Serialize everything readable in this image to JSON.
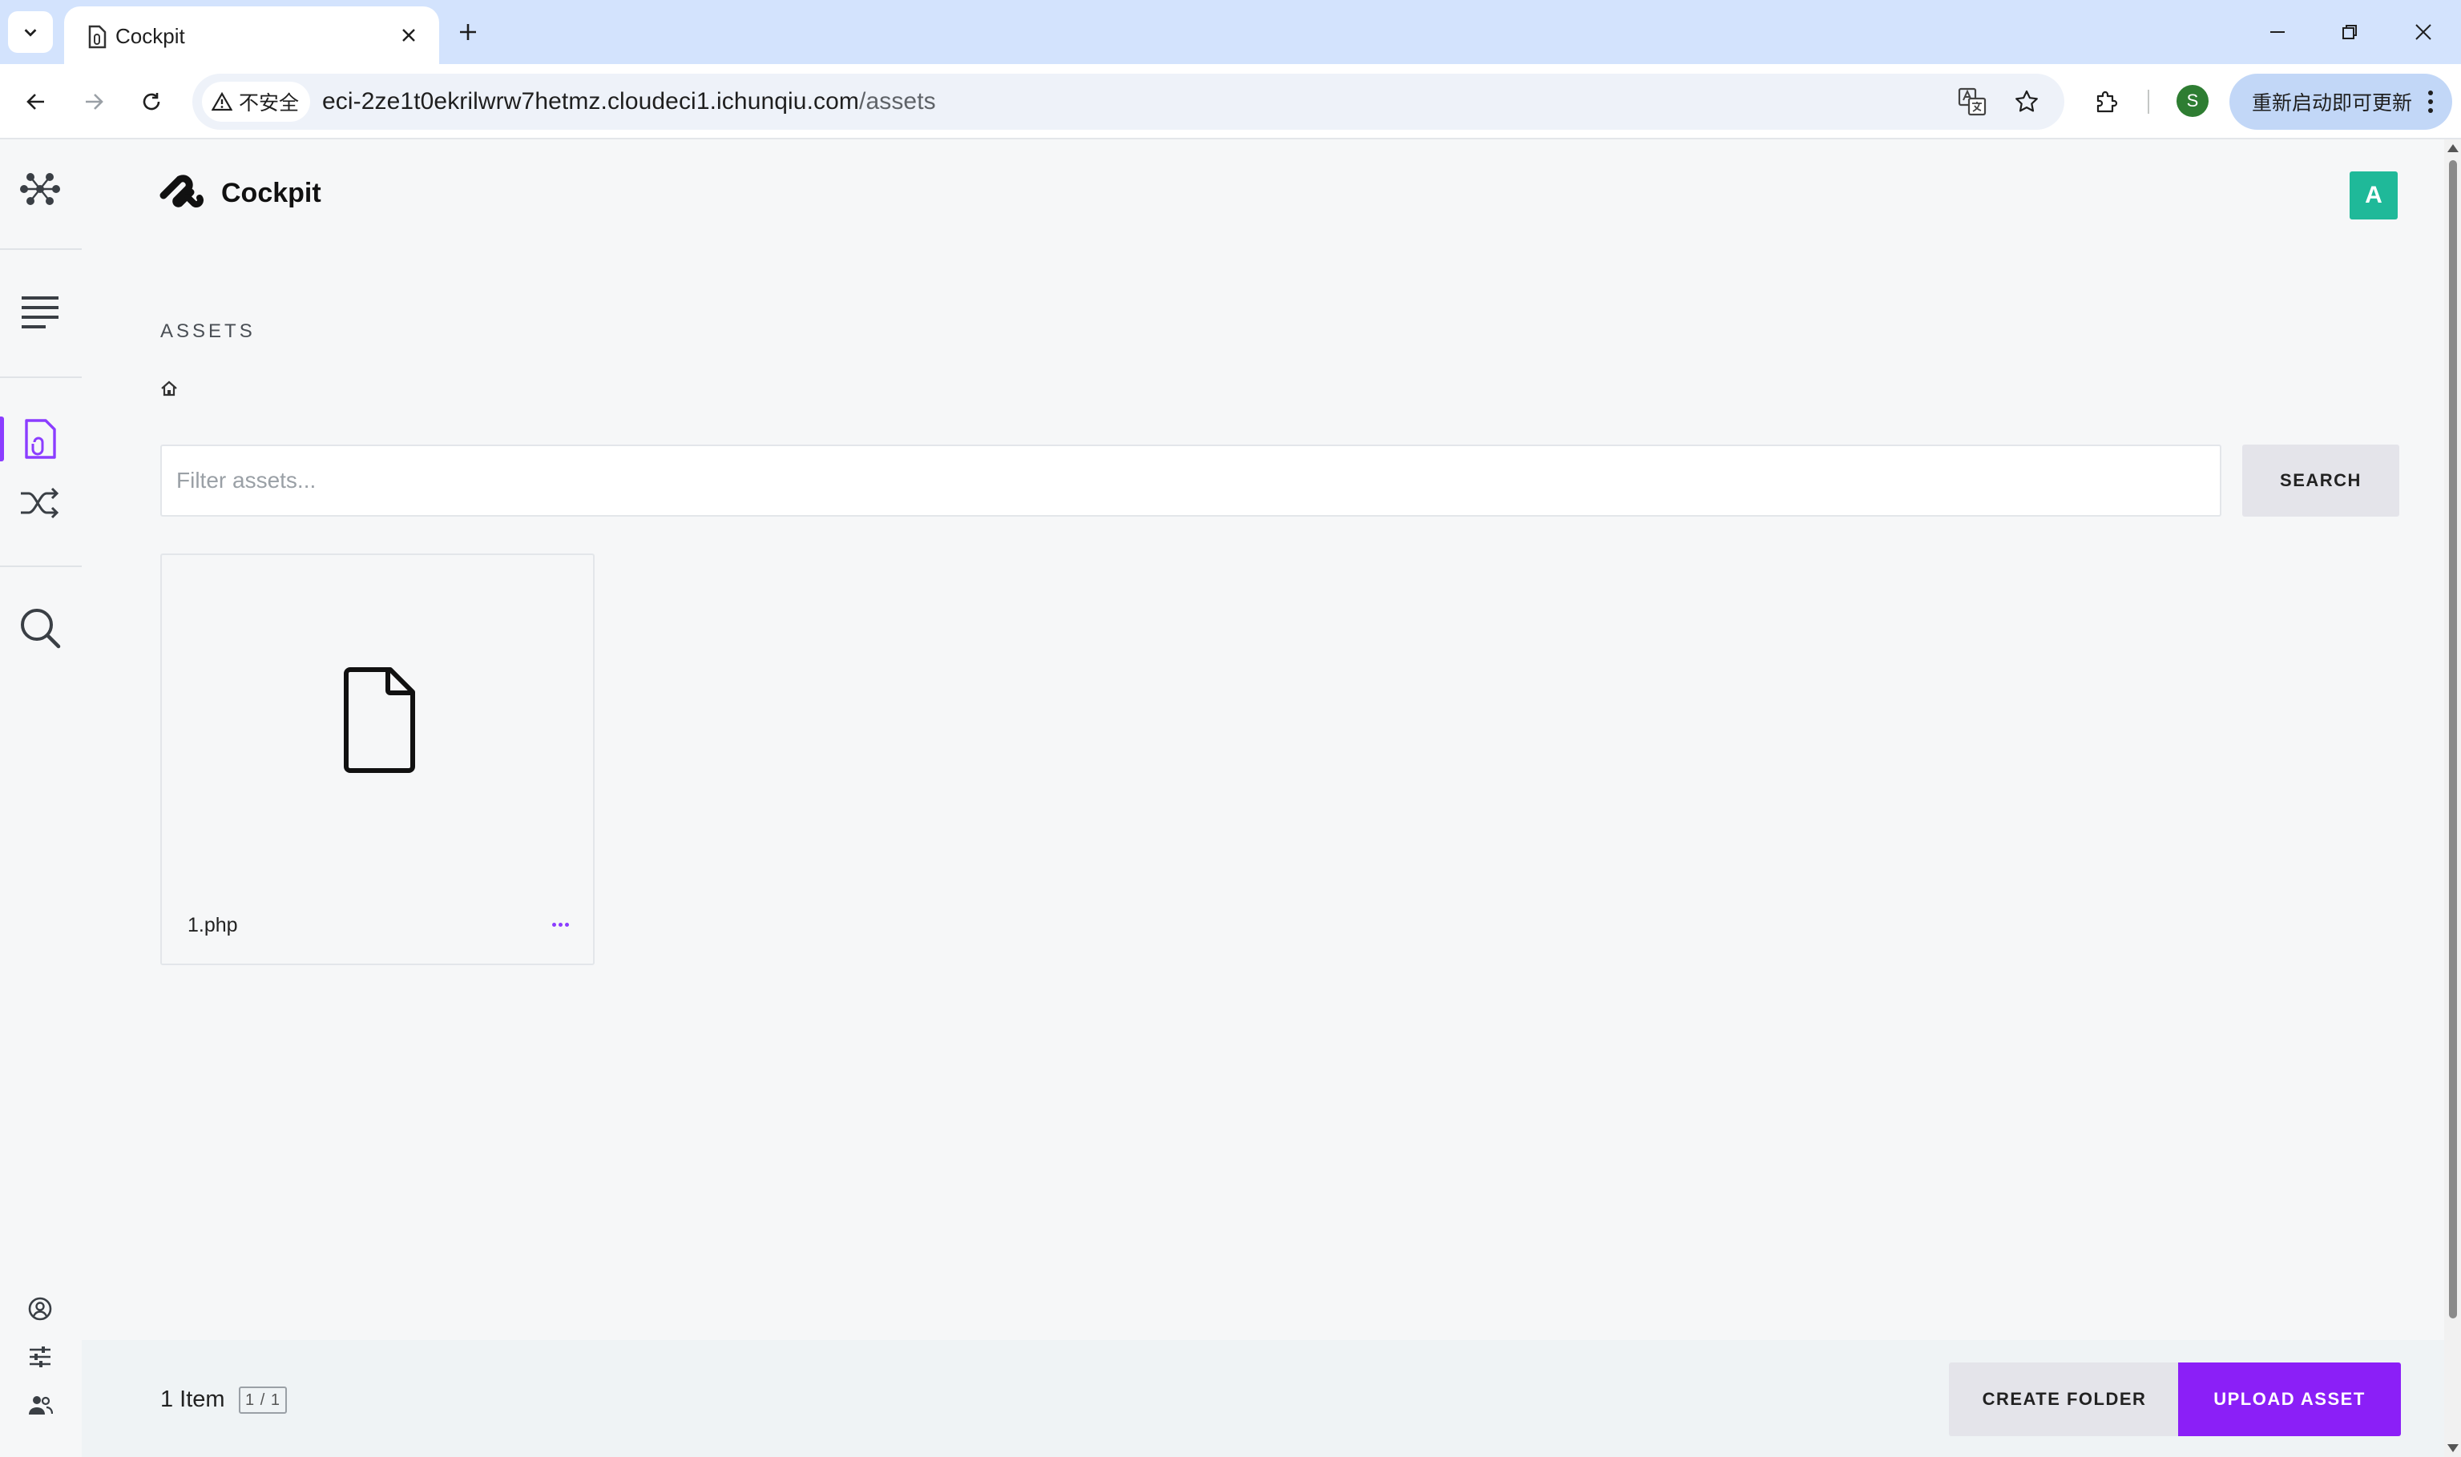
{
  "browser": {
    "tab_title": "Cockpit",
    "security_label": "不安全",
    "url_host": "eci-2ze1t0ekrilwrw7hetmz.cloudeci1.ichunqiu.com",
    "url_path": "/assets",
    "profile_initial": "S",
    "update_label": "重新启动即可更新"
  },
  "app": {
    "brand_name": "Cockpit",
    "user_initial": "A",
    "accent_color": "#8b1ff7",
    "avatar_color": "#1fb999"
  },
  "sidebar": {
    "items": [
      {
        "icon": "modules-icon",
        "active": false
      },
      {
        "icon": "content-list-icon",
        "active": false
      },
      {
        "icon": "assets-icon",
        "active": true
      },
      {
        "icon": "shuffle-icon",
        "active": false
      },
      {
        "icon": "search-icon",
        "active": false
      }
    ],
    "bottom_items": [
      {
        "icon": "account-icon"
      },
      {
        "icon": "settings-sliders-icon"
      },
      {
        "icon": "users-icon"
      }
    ]
  },
  "main": {
    "page_title": "ASSETS",
    "breadcrumb_icon": "home-icon",
    "filter_placeholder": "Filter assets...",
    "search_label": "SEARCH",
    "assets": [
      {
        "name": "1.php",
        "icon": "file-icon"
      }
    ]
  },
  "footer": {
    "item_count": "1 Item",
    "pagination": "1 / 1",
    "create_folder_label": "CREATE FOLDER",
    "upload_asset_label": "UPLOAD ASSET"
  }
}
